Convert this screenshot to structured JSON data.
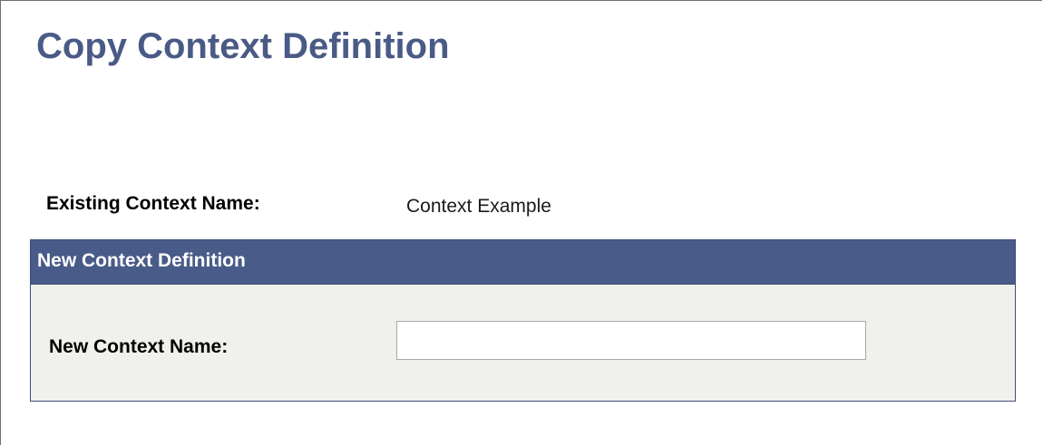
{
  "page": {
    "title": "Copy Context Definition"
  },
  "existing": {
    "label": "Existing Context Name:",
    "value": "Context Example"
  },
  "new_definition": {
    "header": "New Context Definition",
    "name_label": "New Context Name:",
    "name_value": "",
    "name_placeholder": ""
  },
  "colors": {
    "title": "#4a5a86",
    "group_header_bg": "#495b88",
    "group_body_bg": "#f0f1ec"
  }
}
